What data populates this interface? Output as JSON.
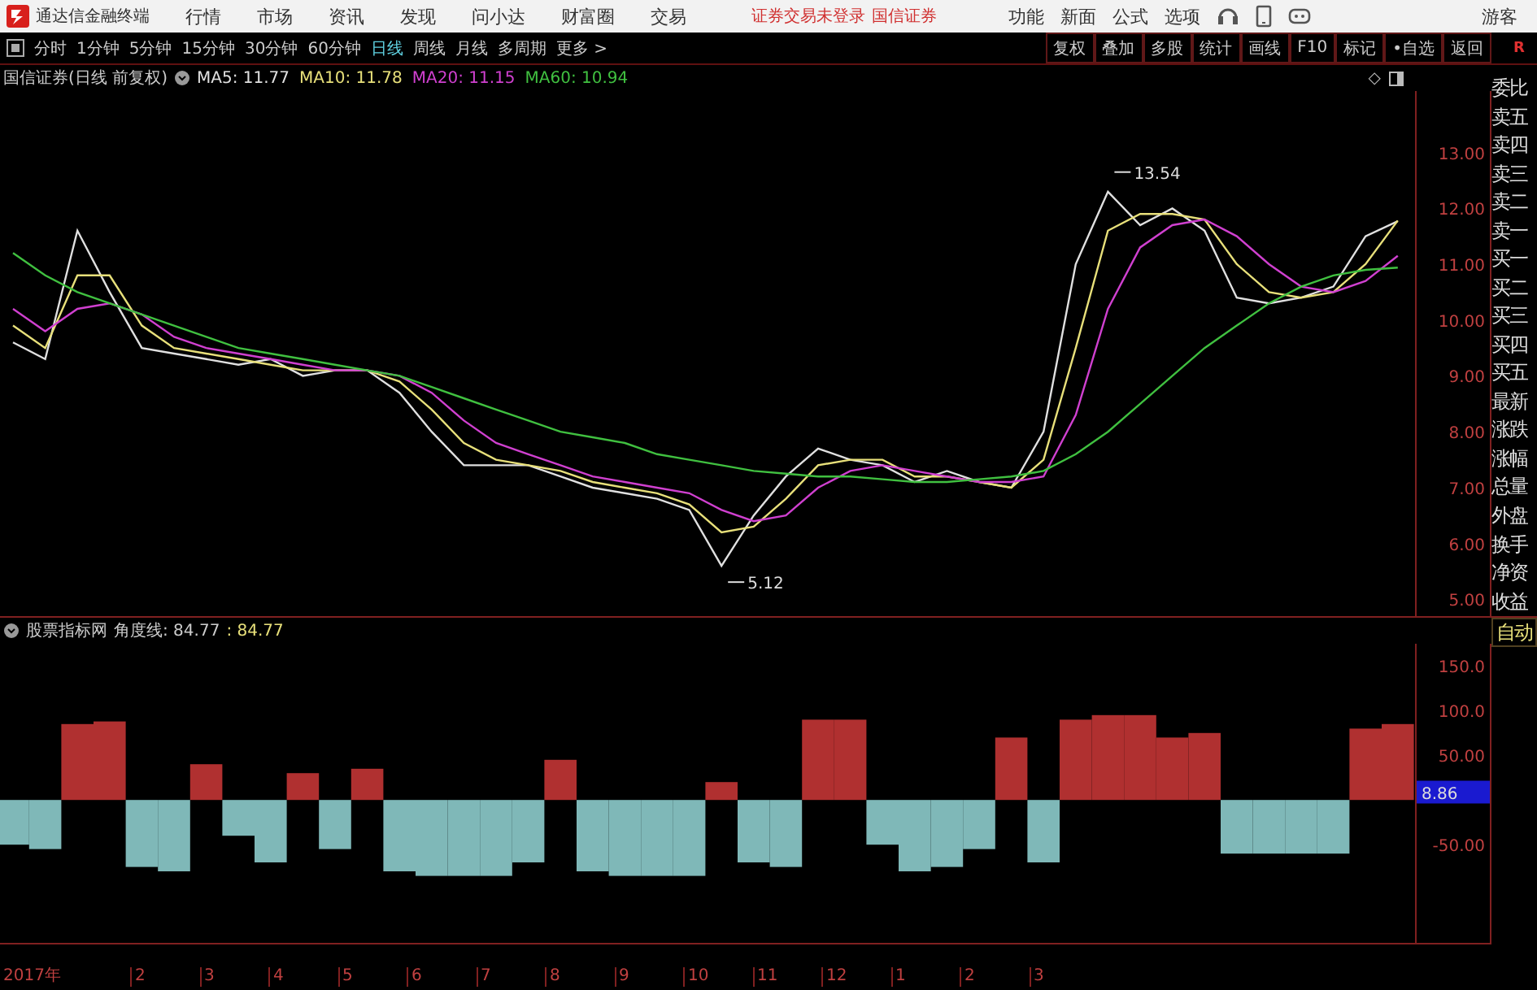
{
  "menubar": {
    "app_title": "通达信金融终端",
    "menus": [
      "行情",
      "市场",
      "资讯",
      "发现",
      "问小达",
      "财富圈",
      "交易"
    ],
    "notices": [
      "证券交易未登录",
      "国信证券"
    ],
    "actions": [
      "功能",
      "新面",
      "公式",
      "选项"
    ],
    "user": "游客"
  },
  "toolbar": {
    "periods": [
      {
        "label": "分时",
        "selected": false
      },
      {
        "label": "1分钟",
        "selected": false
      },
      {
        "label": "5分钟",
        "selected": false
      },
      {
        "label": "15分钟",
        "selected": false
      },
      {
        "label": "30分钟",
        "selected": false
      },
      {
        "label": "60分钟",
        "selected": false
      },
      {
        "label": "日线",
        "selected": true
      },
      {
        "label": "周线",
        "selected": false
      },
      {
        "label": "月线",
        "selected": false
      },
      {
        "label": "多周期",
        "selected": false
      },
      {
        "label": "更多 >",
        "selected": false
      }
    ],
    "buttons": [
      "复权",
      "叠加",
      "多股",
      "统计",
      "画线",
      "F10",
      "标记",
      "•自选",
      "返回"
    ],
    "corner": "R"
  },
  "price_panel": {
    "title": "国信证券(日线 前复权)",
    "legend_readings": [
      ": 11.77",
      ": 11.78",
      ": 11.15",
      ": 10.94"
    ],
    "corner_mark": "◇",
    "chart_data": {
      "type": "line",
      "ylim": [
        4.7,
        14.1
      ],
      "yticks": [
        {
          "value": 13,
          "label": "13.00"
        },
        {
          "value": 12,
          "label": "12.00"
        },
        {
          "value": 11,
          "label": "11.00"
        },
        {
          "value": 10,
          "label": "10.00"
        },
        {
          "value": 9,
          "label": "9.00"
        },
        {
          "value": 8,
          "label": "8.00"
        },
        {
          "value": 7,
          "label": "7.00"
        },
        {
          "value": 6,
          "label": "6.00"
        },
        {
          "value": 5,
          "label": "5.00"
        }
      ],
      "series": [
        {
          "name": "MA5",
          "color": "#e0e0e0",
          "values": [
            9.6,
            9.3,
            11.6,
            10.5,
            9.5,
            9.4,
            9.3,
            9.2,
            9.3,
            9.0,
            9.1,
            9.1,
            8.7,
            8.0,
            7.4,
            7.4,
            7.4,
            7.2,
            7.0,
            6.9,
            6.8,
            6.6,
            5.6,
            6.5,
            7.2,
            7.7,
            7.5,
            7.4,
            7.1,
            7.3,
            7.1,
            7.0,
            8.0,
            11.0,
            12.3,
            11.7,
            12.0,
            11.6,
            10.4,
            10.3,
            10.4,
            10.6,
            11.5,
            11.77
          ]
        },
        {
          "name": "MA10",
          "color": "#e8e07a",
          "values": [
            9.9,
            9.5,
            10.8,
            10.8,
            9.9,
            9.5,
            9.4,
            9.3,
            9.2,
            9.1,
            9.1,
            9.1,
            8.9,
            8.4,
            7.8,
            7.5,
            7.4,
            7.3,
            7.1,
            7.0,
            6.9,
            6.7,
            6.2,
            6.3,
            6.8,
            7.4,
            7.5,
            7.5,
            7.2,
            7.2,
            7.1,
            7.0,
            7.5,
            9.5,
            11.6,
            11.9,
            11.9,
            11.8,
            11.0,
            10.5,
            10.4,
            10.5,
            11.0,
            11.78
          ]
        },
        {
          "name": "MA20",
          "color": "#d040d0",
          "values": [
            10.2,
            9.8,
            10.2,
            10.3,
            10.1,
            9.7,
            9.5,
            9.4,
            9.3,
            9.2,
            9.1,
            9.1,
            9.0,
            8.7,
            8.2,
            7.8,
            7.6,
            7.4,
            7.2,
            7.1,
            7.0,
            6.9,
            6.6,
            6.4,
            6.5,
            7.0,
            7.3,
            7.4,
            7.3,
            7.2,
            7.1,
            7.1,
            7.2,
            8.3,
            10.2,
            11.3,
            11.7,
            11.8,
            11.5,
            11.0,
            10.6,
            10.5,
            10.7,
            11.15
          ]
        },
        {
          "name": "MA60",
          "color": "#40c040",
          "values": [
            11.2,
            10.8,
            10.5,
            10.3,
            10.1,
            9.9,
            9.7,
            9.5,
            9.4,
            9.3,
            9.2,
            9.1,
            9.0,
            8.8,
            8.6,
            8.4,
            8.2,
            8.0,
            7.9,
            7.8,
            7.6,
            7.5,
            7.4,
            7.3,
            7.25,
            7.2,
            7.2,
            7.15,
            7.1,
            7.1,
            7.15,
            7.2,
            7.3,
            7.6,
            8.0,
            8.5,
            9.0,
            9.5,
            9.9,
            10.3,
            10.6,
            10.8,
            10.9,
            10.94
          ]
        }
      ],
      "annotations": [
        "13.54",
        "5.12"
      ]
    }
  },
  "sidebar": {
    "labels": [
      "委比",
      "卖五",
      "卖四",
      "卖三",
      "卖二",
      "卖一",
      "买一",
      "买二",
      "买三",
      "买四",
      "买五",
      "最新",
      "涨跌",
      "涨幅",
      "总量",
      "外盘",
      "换手",
      "净资",
      "收益"
    ],
    "auto_button": "自动"
  },
  "indicator_panel": {
    "title": "股票指标网",
    "reading": ": 84.77",
    "reading_2": ": 84.77",
    "chart_data": {
      "type": "bar",
      "ylim": [
        -160,
        175
      ],
      "yticks": [
        {
          "value": 150,
          "label": "150.0"
        },
        {
          "value": 100,
          "label": "100.0"
        },
        {
          "value": 50,
          "label": "50.00"
        },
        {
          "value": -50,
          "label": "-50.00"
        }
      ],
      "stacked": true,
      "series": [
        {
          "name": "角度线",
          "color": "#b03030",
          "values": [
            null,
            null,
            85,
            88,
            null,
            null,
            40,
            null,
            null,
            30,
            null,
            35,
            null,
            null,
            null,
            null,
            null,
            45,
            null,
            null,
            null,
            null,
            20,
            null,
            null,
            90,
            90,
            null,
            null,
            null,
            null,
            70,
            null,
            90,
            95,
            95,
            70,
            75,
            null,
            null,
            null,
            null,
            80,
            85
          ]
        },
        {
          "color": "#7fb8b8",
          "values": [
            -50,
            -55,
            null,
            null,
            -75,
            -80,
            null,
            -40,
            -70,
            null,
            -55,
            null,
            -80,
            -85,
            -85,
            -85,
            -70,
            null,
            -80,
            -85,
            -85,
            -85,
            null,
            -70,
            -75,
            null,
            null,
            -50,
            -80,
            -75,
            -55,
            null,
            -70,
            null,
            null,
            null,
            null,
            null,
            -60,
            -60,
            -60,
            -60,
            null,
            null
          ]
        }
      ],
      "annotations": [
        "8.86"
      ]
    }
  },
  "date_axis": [
    "2017年",
    "2",
    "3",
    "4",
    "5",
    "6",
    "7",
    "8",
    "9",
    "10",
    "11",
    "12",
    "1",
    "2",
    "3"
  ]
}
